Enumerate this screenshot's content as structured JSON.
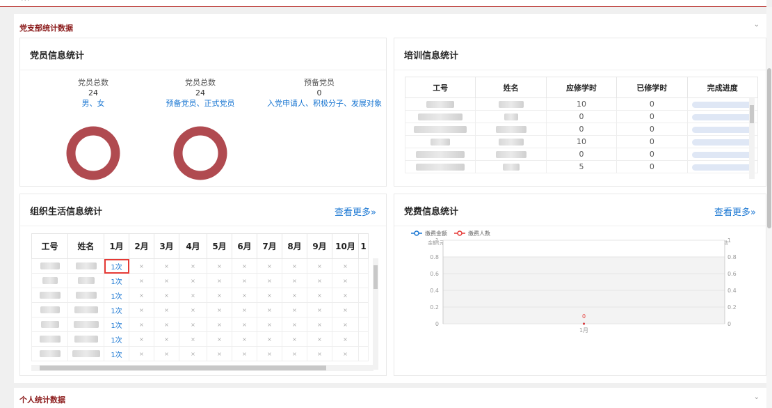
{
  "branch_section": {
    "title": "党支部统计数据"
  },
  "member_stats": {
    "title": "党员信息统计",
    "columns": [
      {
        "label": "党员总数",
        "value": "24",
        "sub": "男、女"
      },
      {
        "label": "党员总数",
        "value": "24",
        "sub": "预备党员、正式党员"
      },
      {
        "label": "预备党员",
        "value": "0",
        "sub": "入党申请人、积极分子、发展对象"
      }
    ],
    "donut_colors": {
      "main": "#b04a50",
      "minor": "#5b8cc4"
    },
    "donut1_minor_fraction": 0.06
  },
  "training": {
    "title": "培训信息统计",
    "headers": [
      "工号",
      "姓名",
      "应修学时",
      "已修学时",
      "完成进度"
    ],
    "rows": [
      {
        "required": "10",
        "done": "0"
      },
      {
        "required": "0",
        "done": "0"
      },
      {
        "required": "0",
        "done": "0"
      },
      {
        "required": "10",
        "done": "0"
      },
      {
        "required": "0",
        "done": "0"
      },
      {
        "required": "5",
        "done": "0"
      }
    ]
  },
  "org_life": {
    "title": "组织生活信息统计",
    "more": "查看更多»",
    "headers": [
      "工号",
      "姓名",
      "1月",
      "2月",
      "3月",
      "4月",
      "5月",
      "6月",
      "7月",
      "8月",
      "9月",
      "10月",
      "1"
    ],
    "count_label": "1次",
    "empty_mark": "×",
    "row_count": 7
  },
  "fee": {
    "title": "党费信息统计",
    "more": "查看更多»",
    "legend": [
      {
        "name": "缴费金额",
        "color": "#1976d2"
      },
      {
        "name": "缴费人数",
        "color": "#e53935"
      }
    ],
    "left_axis_label": "金额(元)",
    "right_axis_label": "人数",
    "y_ticks": [
      "1",
      "0.8",
      "0.6",
      "0.4",
      "0.2",
      "0"
    ],
    "point_label": "0",
    "x_label": "1月"
  },
  "chart_data": {
    "type": "line",
    "categories": [
      "1月"
    ],
    "series": [
      {
        "name": "缴费金额",
        "values": [
          0
        ]
      },
      {
        "name": "缴费人数",
        "values": [
          0
        ]
      }
    ],
    "ylabel": "金额(元)",
    "y2label": "人数",
    "ylim": [
      0,
      1
    ],
    "grid": true,
    "legend_position": "top-left"
  },
  "personal_section": {
    "title": "个人统计数据"
  }
}
